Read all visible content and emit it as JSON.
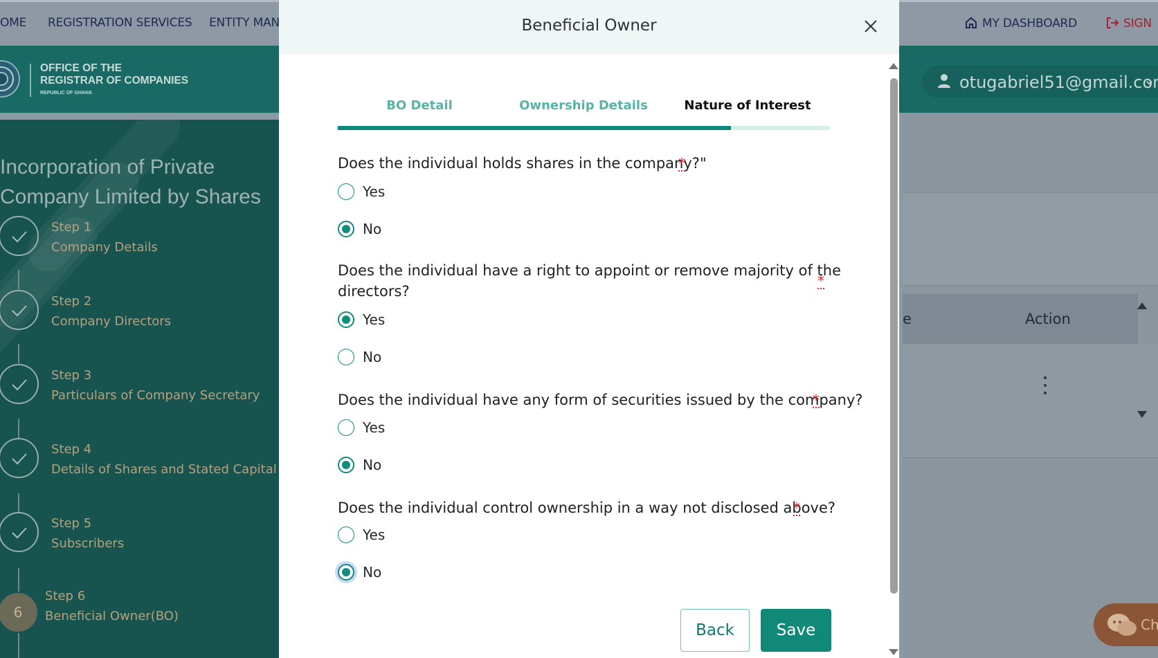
{
  "topnav": {
    "home_label": "OME",
    "registration_label": "REGISTRATION SERVICES",
    "entity_label": "ENTITY MAN",
    "dashboard_label": "MY DASHBOARD",
    "signout_label": "SIGN"
  },
  "brand": {
    "line1": "OFFICE OF THE",
    "line2": "REGISTRAR OF COMPANIES",
    "line3": "REPUBLIC OF GHANA"
  },
  "user": {
    "email": "otugabriel51@gmail.com"
  },
  "sidebar": {
    "title_line1": "Incorporation of Private",
    "title_line2": "Company Limited by Shares",
    "steps": [
      {
        "num": "Step 1",
        "name": "Company Details"
      },
      {
        "num": "Step 2",
        "name": "Company Directors"
      },
      {
        "num": "Step 3",
        "name": "Particulars of Company Secretary"
      },
      {
        "num": "Step 4",
        "name": "Details of Shares and Stated Capital"
      },
      {
        "num": "Step 5",
        "name": "Subscribers"
      },
      {
        "num": "Step 6",
        "name": "Beneficial Owner(BO)",
        "badge": "6"
      }
    ]
  },
  "table": {
    "col_partial": "e",
    "col_action": "Action"
  },
  "chat": {
    "label": "Ch"
  },
  "modal": {
    "title": "Beneficial Owner",
    "tabs": [
      {
        "label": "BO Detail",
        "state": "done"
      },
      {
        "label": "Ownership Details",
        "state": "done"
      },
      {
        "label": "Nature of Interest",
        "state": "active"
      }
    ],
    "progress_fraction": 0.8,
    "required_mark": "*",
    "questions": [
      {
        "text": "Does the individual holds shares in the company?\"",
        "options": [
          "Yes",
          "No"
        ],
        "selected": "No"
      },
      {
        "text_line1": "Does the individual have a right to appoint or remove majority of the",
        "text_line2": "directors?",
        "options": [
          "Yes",
          "No"
        ],
        "selected": "Yes"
      },
      {
        "text": "Does the individual have any form of securities issued by the company?",
        "options": [
          "Yes",
          "No"
        ],
        "selected": "No"
      },
      {
        "text": "Does the individual control ownership in a way not disclosed above?",
        "options": [
          "Yes",
          "No"
        ],
        "selected": "No"
      }
    ],
    "back_label": "Back",
    "save_label": "Save"
  },
  "colors": {
    "accent": "#108979",
    "tab_done": "#55b4a4",
    "required": "#e0262b",
    "sidebar_bg": "#17534f"
  }
}
